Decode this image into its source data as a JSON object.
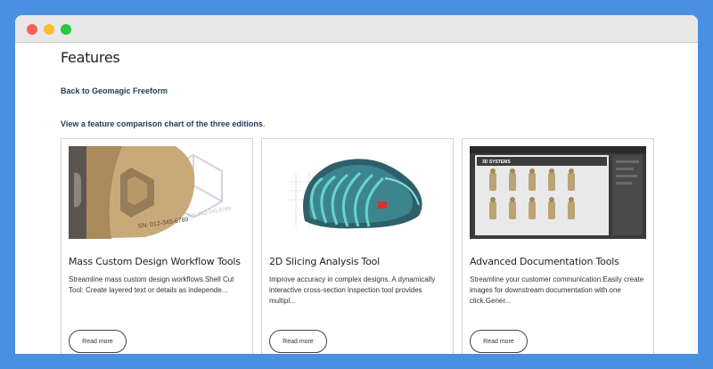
{
  "page": {
    "title": "Features",
    "back_link": "Back to Geomagic Freeform",
    "compare_link": "View a feature comparison chart of the three editions",
    "compare_period": "."
  },
  "cards": [
    {
      "title": "Mass Custom Design Workflow Tools",
      "description": "Streamline mass custom design workflows.Shell Cut Tool: Create layered text or details as independe...",
      "button": "Read more",
      "image_label": "SN: 012-345-6789"
    },
    {
      "title": "2D Slicing Analysis Tool",
      "description": "Improve accuracy in complex designs. A dynamically interactive cross-section inspection tool provides multipl...",
      "button": "Read more"
    },
    {
      "title": "Advanced Documentation Tools",
      "description": "Streamline your customer communication.Easily create images for downstream documentation with one click.Gener...",
      "button": "Read more",
      "image_label": "3D SYSTEMS"
    }
  ],
  "colors": {
    "background": "#4a90e2",
    "link": "#1f3b57"
  }
}
